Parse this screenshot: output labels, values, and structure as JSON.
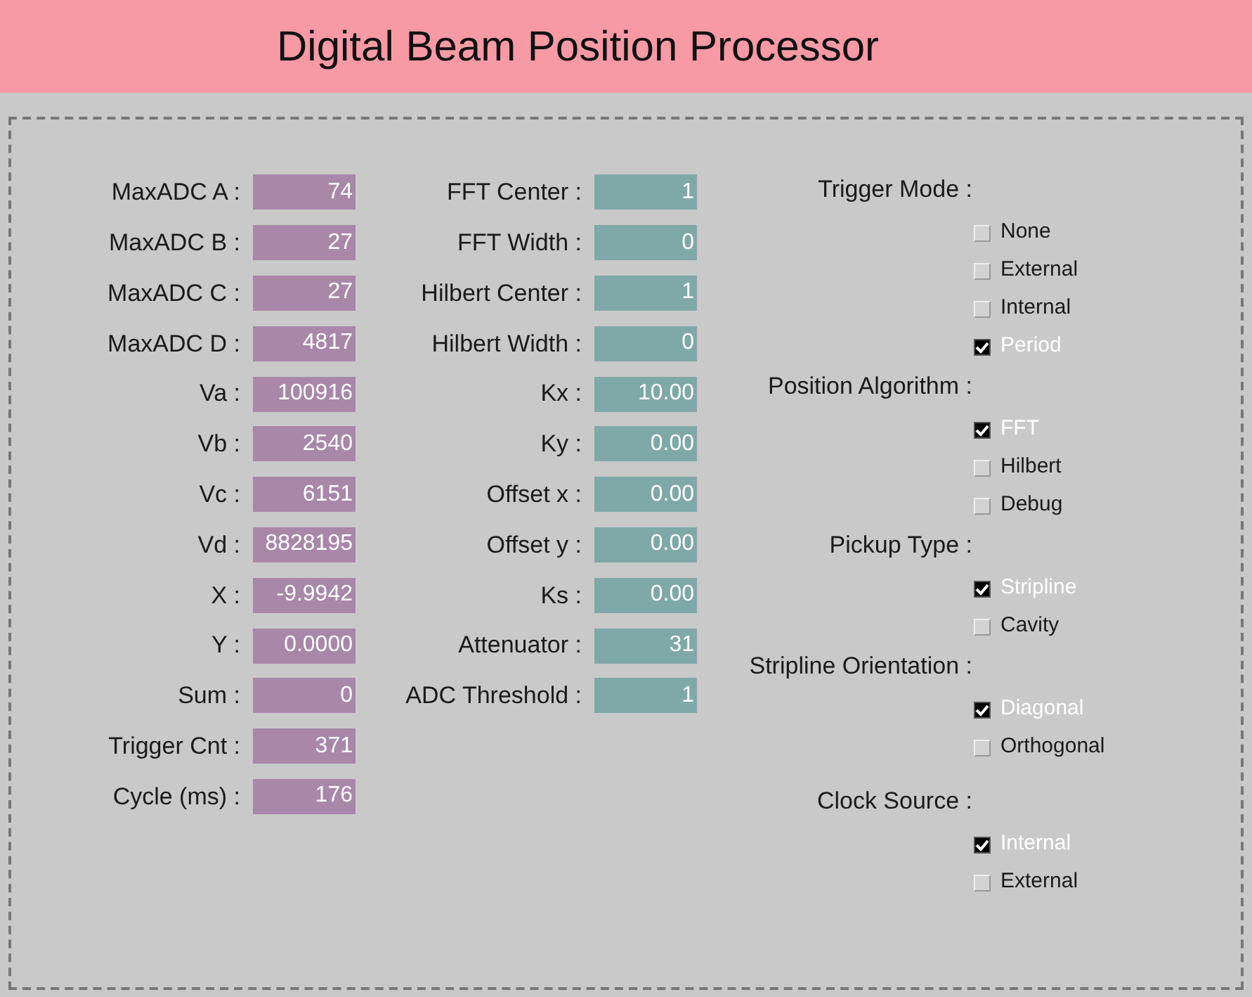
{
  "header": {
    "title": "Digital Beam Position Processor"
  },
  "readouts": [
    {
      "label": "MaxADC A :",
      "value": "74"
    },
    {
      "label": "MaxADC B :",
      "value": "27"
    },
    {
      "label": "MaxADC C :",
      "value": "27"
    },
    {
      "label": "MaxADC D :",
      "value": "4817"
    },
    {
      "label": "Va :",
      "value": "100916"
    },
    {
      "label": "Vb :",
      "value": "2540"
    },
    {
      "label": "Vc :",
      "value": "6151"
    },
    {
      "label": "Vd :",
      "value": "8828195"
    },
    {
      "label": "X :",
      "value": "-9.9942"
    },
    {
      "label": "Y :",
      "value": "0.0000"
    },
    {
      "label": "Sum :",
      "value": "0"
    },
    {
      "label": "Trigger Cnt :",
      "value": "371"
    },
    {
      "label": "Cycle (ms) :",
      "value": "176"
    }
  ],
  "settings": [
    {
      "label": "FFT Center :",
      "value": "1"
    },
    {
      "label": "FFT Width :",
      "value": "0"
    },
    {
      "label": "Hilbert Center :",
      "value": "1"
    },
    {
      "label": "Hilbert Width :",
      "value": "0"
    },
    {
      "label": "Kx :",
      "value": "10.00"
    },
    {
      "label": "Ky :",
      "value": "0.00"
    },
    {
      "label": "Offset x :",
      "value": "0.00"
    },
    {
      "label": "Offset y :",
      "value": "0.00"
    },
    {
      "label": "Ks :",
      "value": "0.00"
    },
    {
      "label": "Attenuator :",
      "value": "31"
    },
    {
      "label": "ADC Threshold :",
      "value": "1"
    }
  ],
  "groups": [
    {
      "title": "Trigger Mode :",
      "options": [
        {
          "label": "None",
          "checked": false
        },
        {
          "label": "External",
          "checked": false
        },
        {
          "label": "Internal",
          "checked": false
        },
        {
          "label": "Period",
          "checked": true
        }
      ]
    },
    {
      "title": "Position Algorithm :",
      "options": [
        {
          "label": "FFT",
          "checked": true
        },
        {
          "label": "Hilbert",
          "checked": false
        },
        {
          "label": "Debug",
          "checked": false
        }
      ]
    },
    {
      "title": "Pickup Type :",
      "options": [
        {
          "label": "Stripline",
          "checked": true
        },
        {
          "label": "Cavity",
          "checked": false
        }
      ]
    },
    {
      "title": "Stripline Orientation :",
      "options": [
        {
          "label": "Diagonal",
          "checked": true
        },
        {
          "label": "Orthogonal",
          "checked": false
        }
      ]
    },
    {
      "title": "Clock Source :",
      "options": [
        {
          "label": "Internal",
          "checked": true
        },
        {
          "label": "External",
          "checked": false
        }
      ]
    }
  ]
}
